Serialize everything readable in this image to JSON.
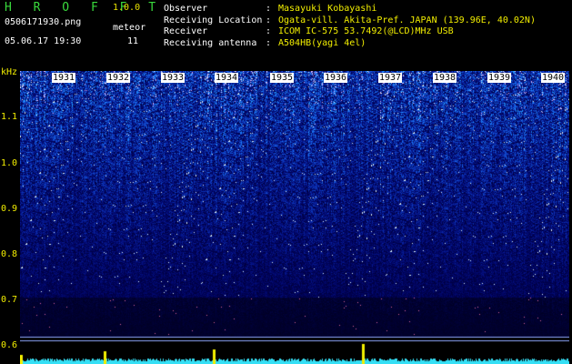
{
  "header": {
    "app_name": "H R O F F T",
    "version": "1.0.0",
    "filename": "0506171930.png",
    "meteor_label": "meteor",
    "datetime": "05.06.17 19:30",
    "meteor_count": "11",
    "info": [
      {
        "key": "Observer",
        "value": "Masayuki Kobayashi"
      },
      {
        "key": "Receiving Location",
        "value": "Ogata-vill. Akita-Pref. JAPAN (139.96E, 40.02N)"
      },
      {
        "key": "Receiver",
        "value": "ICOM IC-575 53.7492(@LCD)MHz USB"
      },
      {
        "key": "Receiving antenna",
        "value": "A504HB(yagi 4el)"
      }
    ]
  },
  "spectrogram": {
    "y_unit": "kHz",
    "y_ticks": [
      "1.1",
      "1.0",
      "0.9",
      "0.8",
      "0.7",
      "0.6"
    ],
    "x_ticks": [
      "1931",
      "1932",
      "1933",
      "1934",
      "1935",
      "1936",
      "1937",
      "1938",
      "1939",
      "1940"
    ],
    "colors": {
      "background": "#000000",
      "noise_low": "#0a2aa0",
      "noise_high": "#7ad6ff",
      "label": "#f2ee00",
      "trace": "#35dff5"
    }
  }
}
